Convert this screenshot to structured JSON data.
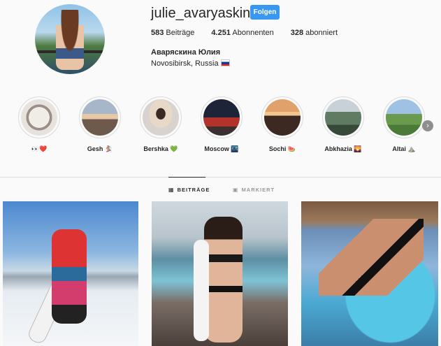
{
  "profile": {
    "username": "julie_avaryaskina",
    "follow_label": "Folgen",
    "stats": {
      "posts_count": "583",
      "posts_label": "Beiträge",
      "followers_count": "4.251",
      "followers_label": "Abonnenten",
      "following_count": "328",
      "following_label": "abonniert"
    },
    "full_name": "Аваряскина Юлия",
    "location": "Novosibirsk, Russia"
  },
  "highlights": [
    {
      "label": "👀❤️",
      "color": "#e8e2dc"
    },
    {
      "label": "Gesh 🏂",
      "color": "#c9a48a"
    },
    {
      "label": "Bershka 💚",
      "color": "#d8d3ce"
    },
    {
      "label": "Moscow 🌃",
      "color": "#2c2c3c"
    },
    {
      "label": "Sochi 🍉",
      "color": "#b07a56"
    },
    {
      "label": "Abkhazia 🌄",
      "color": "#7d8f9c"
    },
    {
      "label": "Altai ⛰️",
      "color": "#86aa6a"
    }
  ],
  "tabs": {
    "posts_label": "BEITRÄGE",
    "tagged_label": "MARKIERT"
  },
  "icons": {
    "grid": "grid-icon",
    "tagged": "tagged-icon",
    "next": "chevron-right-icon"
  },
  "colors": {
    "accent": "#3897f0",
    "background": "#fafafa",
    "text": "#262626",
    "border": "#dbdbdb"
  }
}
